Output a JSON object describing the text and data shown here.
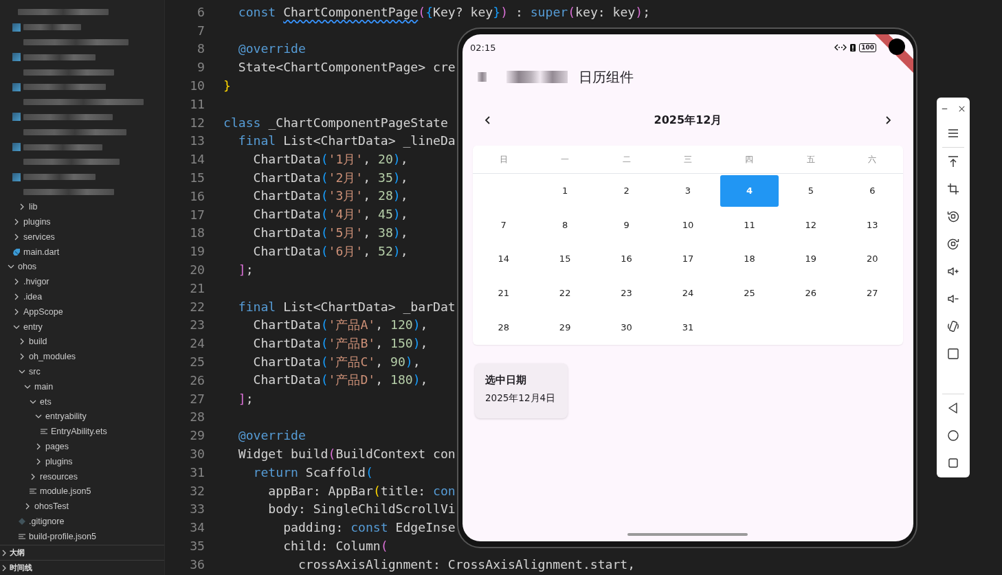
{
  "explorer": {
    "items": [
      {
        "kind": "blurred",
        "children": [
          {
            "kind": "blurred-file"
          },
          {
            "kind": "blurred"
          },
          {
            "kind": "blurred-file"
          },
          {
            "kind": "blurred"
          },
          {
            "kind": "blurred-file"
          },
          {
            "kind": "blurred"
          },
          {
            "kind": "blurred-file"
          },
          {
            "kind": "blurred"
          },
          {
            "kind": "blurred-file"
          },
          {
            "kind": "blurred"
          },
          {
            "kind": "blurred-file"
          },
          {
            "kind": "blurred",
            "children": [
              {
                "kind": "folder",
                "label": "lib",
                "expanded": false
              }
            ]
          },
          {
            "kind": "folder",
            "label": "plugins",
            "expanded": false
          },
          {
            "kind": "folder",
            "label": "services",
            "expanded": false
          },
          {
            "kind": "dart-file",
            "label": "main.dart"
          }
        ]
      },
      {
        "kind": "folder",
        "label": "ohos",
        "expanded": true,
        "children": [
          {
            "kind": "folder",
            "label": ".hvigor",
            "expanded": false
          },
          {
            "kind": "folder",
            "label": ".idea",
            "expanded": false
          },
          {
            "kind": "folder",
            "label": "AppScope",
            "expanded": false
          },
          {
            "kind": "folder",
            "label": "entry",
            "expanded": true,
            "children": [
              {
                "kind": "folder",
                "label": "build",
                "expanded": false
              },
              {
                "kind": "folder",
                "label": "oh_modules",
                "expanded": false
              },
              {
                "kind": "folder",
                "label": "src",
                "expanded": true,
                "children": [
                  {
                    "kind": "folder",
                    "label": "main",
                    "expanded": true,
                    "children": [
                      {
                        "kind": "folder",
                        "label": "ets",
                        "expanded": true,
                        "children": [
                          {
                            "kind": "folder",
                            "label": "entryability",
                            "expanded": true,
                            "children": [
                              {
                                "kind": "text-file",
                                "label": "EntryAbility.ets"
                              }
                            ]
                          },
                          {
                            "kind": "folder",
                            "label": "pages",
                            "expanded": false
                          },
                          {
                            "kind": "folder",
                            "label": "plugins",
                            "expanded": false
                          }
                        ]
                      },
                      {
                        "kind": "folder",
                        "label": "resources",
                        "expanded": false
                      },
                      {
                        "kind": "text-file",
                        "label": "module.json5"
                      }
                    ]
                  },
                  {
                    "kind": "folder",
                    "label": "ohosTest",
                    "expanded": false
                  }
                ]
              },
              {
                "kind": "git-file",
                "label": ".gitignore"
              },
              {
                "kind": "text-file",
                "label": "build-profile.json5"
              }
            ]
          }
        ]
      }
    ],
    "panels": [
      {
        "label": "大纲",
        "expanded": false
      },
      {
        "label": "时间线",
        "expanded": false
      }
    ]
  },
  "editor": {
    "lines": [
      {
        "number": "6",
        "tokens": [
          {
            "text": "  const ",
            "kind": "keyword"
          },
          {
            "text": "ChartComponentPage",
            "kind": "warning"
          },
          {
            "text": "(",
            "kind": "bracket1"
          },
          {
            "text": "{",
            "kind": "bracket2"
          },
          {
            "text": "Key? key",
            "kind": "plain"
          },
          {
            "text": "}",
            "kind": "bracket2"
          },
          {
            "text": ")",
            "kind": "bracket1"
          },
          {
            "text": " : ",
            "kind": "plain"
          },
          {
            "text": "super",
            "kind": "keyword"
          },
          {
            "text": "(",
            "kind": "bracket1"
          },
          {
            "text": "key: key",
            "kind": "plain"
          },
          {
            "text": ")",
            "kind": "bracket1"
          },
          {
            "text": ";",
            "kind": "plain"
          }
        ]
      },
      {
        "number": "7"
      },
      {
        "number": "8",
        "tokens": [
          {
            "text": "  @override",
            "kind": "keyword"
          }
        ]
      },
      {
        "number": "9",
        "tokens": [
          {
            "text": "  State<ChartComponentPage> cre",
            "kind": "plain"
          }
        ]
      },
      {
        "number": "10",
        "tokens": [
          {
            "text": "}",
            "kind": "bracket3"
          }
        ]
      },
      {
        "number": "11"
      },
      {
        "number": "12",
        "tokens": [
          {
            "text": "class ",
            "kind": "keyword"
          },
          {
            "text": "_ChartComponentPageState",
            "kind": "plain"
          }
        ]
      },
      {
        "number": "13",
        "tokens": [
          {
            "text": "  final ",
            "kind": "keyword"
          },
          {
            "text": "List<ChartData> _lineDa",
            "kind": "plain"
          }
        ]
      },
      {
        "number": "14",
        "tokens": [
          {
            "text": "    ChartData",
            "kind": "plain"
          },
          {
            "text": "(",
            "kind": "bracket2"
          },
          {
            "text": "'1月'",
            "kind": "string"
          },
          {
            "text": ", ",
            "kind": "plain"
          },
          {
            "text": "20",
            "kind": "number"
          },
          {
            "text": ")",
            "kind": "bracket2"
          },
          {
            "text": ",",
            "kind": "plain"
          }
        ]
      },
      {
        "number": "15",
        "tokens": [
          {
            "text": "    ChartData",
            "kind": "plain"
          },
          {
            "text": "(",
            "kind": "bracket2"
          },
          {
            "text": "'2月'",
            "kind": "string"
          },
          {
            "text": ", ",
            "kind": "plain"
          },
          {
            "text": "35",
            "kind": "number"
          },
          {
            "text": ")",
            "kind": "bracket2"
          },
          {
            "text": ",",
            "kind": "plain"
          }
        ]
      },
      {
        "number": "16",
        "tokens": [
          {
            "text": "    ChartData",
            "kind": "plain"
          },
          {
            "text": "(",
            "kind": "bracket2"
          },
          {
            "text": "'3月'",
            "kind": "string"
          },
          {
            "text": ", ",
            "kind": "plain"
          },
          {
            "text": "28",
            "kind": "number"
          },
          {
            "text": ")",
            "kind": "bracket2"
          },
          {
            "text": ",",
            "kind": "plain"
          }
        ]
      },
      {
        "number": "17",
        "tokens": [
          {
            "text": "    ChartData",
            "kind": "plain"
          },
          {
            "text": "(",
            "kind": "bracket2"
          },
          {
            "text": "'4月'",
            "kind": "string"
          },
          {
            "text": ", ",
            "kind": "plain"
          },
          {
            "text": "45",
            "kind": "number"
          },
          {
            "text": ")",
            "kind": "bracket2"
          },
          {
            "text": ",",
            "kind": "plain"
          }
        ]
      },
      {
        "number": "18",
        "tokens": [
          {
            "text": "    ChartData",
            "kind": "plain"
          },
          {
            "text": "(",
            "kind": "bracket2"
          },
          {
            "text": "'5月'",
            "kind": "string"
          },
          {
            "text": ", ",
            "kind": "plain"
          },
          {
            "text": "38",
            "kind": "number"
          },
          {
            "text": ")",
            "kind": "bracket2"
          },
          {
            "text": ",",
            "kind": "plain"
          }
        ]
      },
      {
        "number": "19",
        "tokens": [
          {
            "text": "    ChartData",
            "kind": "plain"
          },
          {
            "text": "(",
            "kind": "bracket2"
          },
          {
            "text": "'6月'",
            "kind": "string"
          },
          {
            "text": ", ",
            "kind": "plain"
          },
          {
            "text": "52",
            "kind": "number"
          },
          {
            "text": ")",
            "kind": "bracket2"
          },
          {
            "text": ",",
            "kind": "plain"
          }
        ]
      },
      {
        "number": "20",
        "tokens": [
          {
            "text": "  ]",
            "kind": "bracket1"
          },
          {
            "text": ";",
            "kind": "plain"
          }
        ]
      },
      {
        "number": "21"
      },
      {
        "number": "22",
        "tokens": [
          {
            "text": "  final ",
            "kind": "keyword"
          },
          {
            "text": "List<ChartData> _barDat",
            "kind": "plain"
          }
        ]
      },
      {
        "number": "23",
        "tokens": [
          {
            "text": "    ChartData",
            "kind": "plain"
          },
          {
            "text": "(",
            "kind": "bracket2"
          },
          {
            "text": "'产品A'",
            "kind": "string"
          },
          {
            "text": ", ",
            "kind": "plain"
          },
          {
            "text": "120",
            "kind": "number"
          },
          {
            "text": ")",
            "kind": "bracket2"
          },
          {
            "text": ",",
            "kind": "plain"
          }
        ]
      },
      {
        "number": "24",
        "tokens": [
          {
            "text": "    ChartData",
            "kind": "plain"
          },
          {
            "text": "(",
            "kind": "bracket2"
          },
          {
            "text": "'产品B'",
            "kind": "string"
          },
          {
            "text": ", ",
            "kind": "plain"
          },
          {
            "text": "150",
            "kind": "number"
          },
          {
            "text": ")",
            "kind": "bracket2"
          },
          {
            "text": ",",
            "kind": "plain"
          }
        ]
      },
      {
        "number": "25",
        "tokens": [
          {
            "text": "    ChartData",
            "kind": "plain"
          },
          {
            "text": "(",
            "kind": "bracket2"
          },
          {
            "text": "'产品C'",
            "kind": "string"
          },
          {
            "text": ", ",
            "kind": "plain"
          },
          {
            "text": "90",
            "kind": "number"
          },
          {
            "text": ")",
            "kind": "bracket2"
          },
          {
            "text": ",",
            "kind": "plain"
          }
        ]
      },
      {
        "number": "26",
        "tokens": [
          {
            "text": "    ChartData",
            "kind": "plain"
          },
          {
            "text": "(",
            "kind": "bracket2"
          },
          {
            "text": "'产品D'",
            "kind": "string"
          },
          {
            "text": ", ",
            "kind": "plain"
          },
          {
            "text": "180",
            "kind": "number"
          },
          {
            "text": ")",
            "kind": "bracket2"
          },
          {
            "text": ",",
            "kind": "plain"
          }
        ]
      },
      {
        "number": "27",
        "tokens": [
          {
            "text": "  ]",
            "kind": "bracket1"
          },
          {
            "text": ";",
            "kind": "plain"
          }
        ]
      },
      {
        "number": "28"
      },
      {
        "number": "29",
        "tokens": [
          {
            "text": "  @override",
            "kind": "keyword"
          }
        ]
      },
      {
        "number": "30",
        "tokens": [
          {
            "text": "  Widget build",
            "kind": "plain"
          },
          {
            "text": "(",
            "kind": "bracket1"
          },
          {
            "text": "BuildContext con",
            "kind": "plain"
          }
        ]
      },
      {
        "number": "31",
        "tokens": [
          {
            "text": "    return ",
            "kind": "keyword"
          },
          {
            "text": "Scaffold",
            "kind": "plain"
          },
          {
            "text": "(",
            "kind": "bracket2"
          }
        ]
      },
      {
        "number": "32",
        "tokens": [
          {
            "text": "      appBar: AppBar",
            "kind": "plain"
          },
          {
            "text": "(",
            "kind": "bracket3"
          },
          {
            "text": "title: ",
            "kind": "plain"
          },
          {
            "text": "con",
            "kind": "keyword"
          }
        ]
      },
      {
        "number": "33",
        "tokens": [
          {
            "text": "      body: SingleChildScrollVi",
            "kind": "plain"
          }
        ]
      },
      {
        "number": "34",
        "tokens": [
          {
            "text": "        padding: ",
            "kind": "plain"
          },
          {
            "text": "const ",
            "kind": "keyword"
          },
          {
            "text": "EdgeInse",
            "kind": "plain"
          }
        ]
      },
      {
        "number": "35",
        "tokens": [
          {
            "text": "        child: Column",
            "kind": "plain"
          },
          {
            "text": "(",
            "kind": "bracket1"
          }
        ]
      },
      {
        "number": "36",
        "tokens": [
          {
            "text": "          crossAxisAlignment: CrossAxisAlignment.start,",
            "kind": "plain"
          }
        ]
      }
    ]
  },
  "device": {
    "status_bar": {
      "time": "02:15",
      "battery": "100"
    },
    "app_bar": {
      "title": "日历组件"
    },
    "calendar": {
      "month": "2025年12月",
      "weekdays": [
        "日",
        "一",
        "二",
        "三",
        "四",
        "五",
        "六"
      ],
      "weeks": [
        {
          "days": [
            {
              "label": "1",
              "selected": false
            },
            {
              "label": "2",
              "selected": false
            },
            {
              "label": "3",
              "selected": false
            },
            {
              "label": "4",
              "selected": true
            },
            {
              "label": "5",
              "selected": false
            },
            {
              "label": "6",
              "selected": false
            }
          ]
        },
        {
          "days": [
            {
              "label": "7",
              "selected": false
            },
            {
              "label": "8",
              "selected": false
            },
            {
              "label": "9",
              "selected": false
            },
            {
              "label": "10",
              "selected": false
            },
            {
              "label": "11",
              "selected": false
            },
            {
              "label": "12",
              "selected": false
            },
            {
              "label": "13",
              "selected": false
            }
          ]
        },
        {
          "days": [
            {
              "label": "14",
              "selected": false
            },
            {
              "label": "15",
              "selected": false
            },
            {
              "label": "16",
              "selected": false
            },
            {
              "label": "17",
              "selected": false
            },
            {
              "label": "18",
              "selected": false
            },
            {
              "label": "19",
              "selected": false
            },
            {
              "label": "20",
              "selected": false
            }
          ]
        },
        {
          "days": [
            {
              "label": "21",
              "selected": false
            },
            {
              "label": "22",
              "selected": false
            },
            {
              "label": "23",
              "selected": false
            },
            {
              "label": "24",
              "selected": false
            },
            {
              "label": "25",
              "selected": false
            },
            {
              "label": "26",
              "selected": false
            },
            {
              "label": "27",
              "selected": false
            }
          ]
        },
        {
          "days": [
            {
              "label": "28",
              "selected": false
            },
            {
              "label": "29",
              "selected": false
            },
            {
              "label": "30",
              "selected": false
            },
            {
              "label": "31",
              "selected": false
            }
          ]
        }
      ]
    },
    "selection_card": {
      "title": "选中日期",
      "value": "2025年12月4日"
    }
  },
  "tool_strip": {
    "window_controls": [
      {
        "kind": "minimize"
      },
      {
        "kind": "close"
      }
    ],
    "groups": [
      {
        "items": [
          {
            "kind": "menu"
          }
        ]
      },
      {
        "items": [
          {
            "kind": "top"
          },
          {
            "kind": "crop"
          },
          {
            "kind": "rotate-left"
          },
          {
            "kind": "rotate-right"
          },
          {
            "kind": "volume-up"
          },
          {
            "kind": "volume-down"
          },
          {
            "kind": "rotate-device"
          },
          {
            "kind": "screenshot"
          }
        ]
      },
      {
        "items": [
          {
            "kind": "back"
          },
          {
            "kind": "home"
          },
          {
            "kind": "recents"
          }
        ]
      }
    ]
  }
}
